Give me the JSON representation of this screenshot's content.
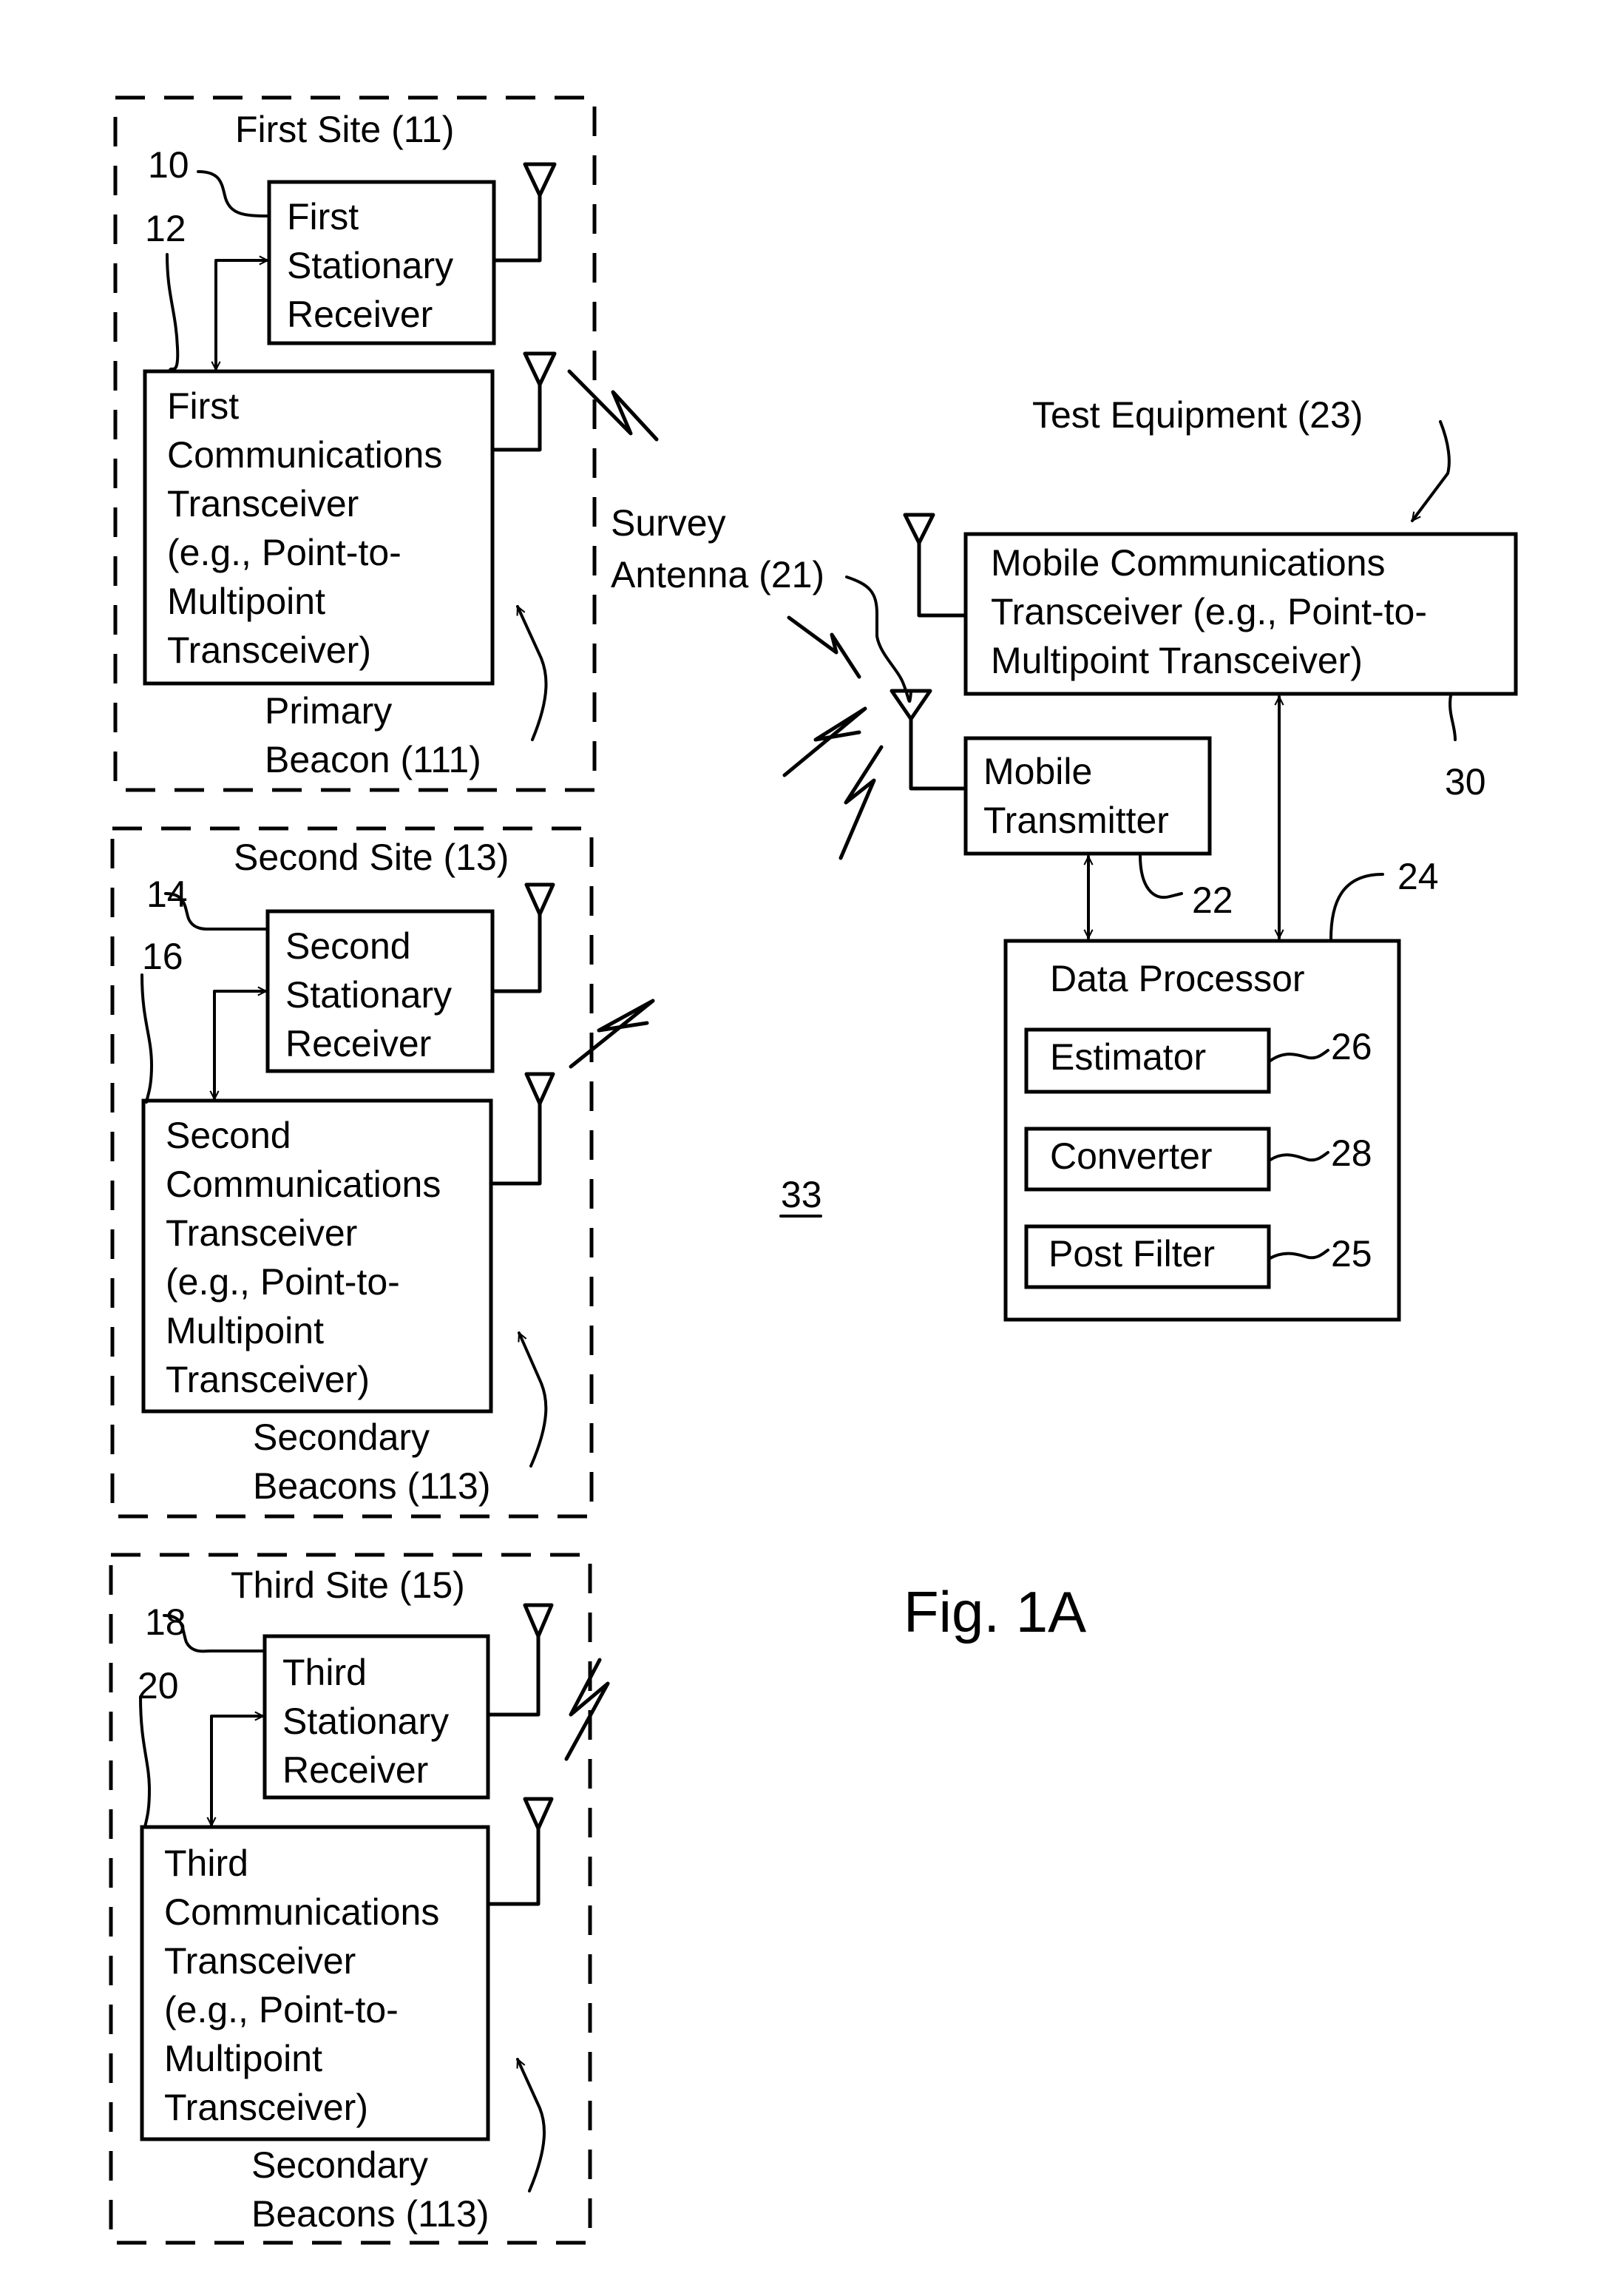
{
  "figure": {
    "caption": "Fig. 1A",
    "system_ref": "33"
  },
  "sites": [
    {
      "title": "First Site (11)",
      "receiver_ref": "10",
      "transceiver_ref": "12",
      "receiver_lines": [
        "First",
        "Stationary",
        "Receiver"
      ],
      "transceiver_lines": [
        "First",
        "Communications",
        "Transceiver",
        "(e.g., Point-to-",
        "Multipoint",
        "Transceiver)"
      ],
      "beacon_lines": [
        "Primary",
        "Beacon (111)"
      ]
    },
    {
      "title": "Second Site (13)",
      "receiver_ref": "14",
      "transceiver_ref": "16",
      "receiver_lines": [
        "Second",
        "Stationary",
        "Receiver"
      ],
      "transceiver_lines": [
        "Second",
        "Communications",
        "Transceiver",
        "(e.g., Point-to-",
        "Multipoint",
        "Transceiver)"
      ],
      "beacon_lines": [
        "Secondary",
        "Beacons (113)"
      ]
    },
    {
      "title": "Third Site (15)",
      "receiver_ref": "18",
      "transceiver_ref": "20",
      "receiver_lines": [
        "Third",
        "Stationary",
        "Receiver"
      ],
      "transceiver_lines": [
        "Third",
        "Communications",
        "Transceiver",
        "(e.g., Point-to-",
        "Multipoint",
        "Transceiver)"
      ],
      "beacon_lines": [
        "Secondary",
        "Beacons (113)"
      ]
    }
  ],
  "survey_antenna": {
    "lines": [
      "Survey",
      "Antenna (21)"
    ]
  },
  "test_equipment": {
    "label": "Test Equipment (23)",
    "mobile_transceiver_lines": [
      "Mobile Communications",
      "Transceiver (e.g., Point-to-",
      "Multipoint Transceiver)"
    ],
    "mobile_transceiver_ref": "30",
    "mobile_transmitter_lines": [
      "Mobile",
      "Transmitter"
    ],
    "mobile_transmitter_ref": "22",
    "data_processor": {
      "title": "Data Processor",
      "ref": "24",
      "modules": [
        {
          "label": "Estimator",
          "ref": "26"
        },
        {
          "label": "Converter",
          "ref": "28"
        },
        {
          "label": "Post Filter",
          "ref": "25"
        }
      ]
    }
  }
}
